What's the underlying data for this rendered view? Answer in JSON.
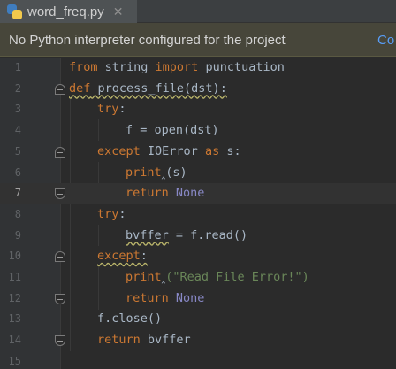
{
  "tab": {
    "title": "word_freq.py",
    "close": "✕"
  },
  "banner": {
    "message": "No Python interpreter configured for the project",
    "link": "Co"
  },
  "gutter": {
    "line_numbers": [
      "1",
      "2",
      "3",
      "4",
      "5",
      "6",
      "7",
      "8",
      "9",
      "10",
      "11",
      "12",
      "13",
      "14",
      "15"
    ]
  },
  "code": {
    "l1": {
      "kw1": "from",
      "t1": " string ",
      "kw2": "import",
      "t2": " punctuation"
    },
    "l2": {
      "kw": "def",
      "t": " process_file(dst):"
    },
    "l3": {
      "kw": "try",
      "t": ":"
    },
    "l4": {
      "t": "f = open(dst)"
    },
    "l5": {
      "kw1": "except",
      "t1": " IOError ",
      "kw2": "as",
      "t2": " s:"
    },
    "l6": {
      "t1": "print",
      "t2": "(s)"
    },
    "l7": {
      "kw": "return",
      "none": "None"
    },
    "l8": {
      "kw": "try",
      "t": ":"
    },
    "l9": {
      "t1": "bvffer",
      "t2": " = f.read()"
    },
    "l10": {
      "kw": "except",
      "t": ":"
    },
    "l11": {
      "t1": "print",
      "str": "(\"Read File Error!\")"
    },
    "l12": {
      "kw": "return",
      "none": "None"
    },
    "l13": {
      "t": "f.close()"
    },
    "l14": {
      "kw": "return",
      "t": " bvffer"
    }
  },
  "colors": {
    "keyword": "#cc7832",
    "none_literal": "#8888c6",
    "string": "#6a8759",
    "default_text": "#a9b7c6",
    "banner_link": "#589df6"
  }
}
